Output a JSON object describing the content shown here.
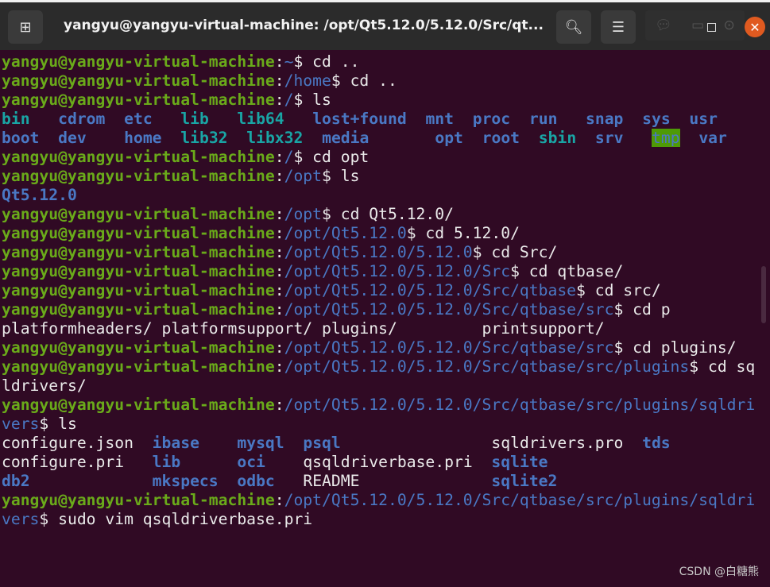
{
  "window": {
    "title": "yangyu@yangyu-virtual-machine: /opt/Qt5.12.0/5.12.0/Src/qt...",
    "new_tab_icon": "new-tab-icon",
    "search_icon": "search-icon",
    "menu_icon": "hamburger-menu-icon",
    "close_icon": "close-icon"
  },
  "colors": {
    "background": "#300a24",
    "prompt_user": "#6aaa1a",
    "prompt_path": "#4a78c4",
    "directory": "#4a78c4",
    "symlink": "#19a5a5",
    "sticky_dir_bg": "#4e9a06",
    "close_button": "#e05a20"
  },
  "terminal": {
    "lines": [
      [
        [
          "yangyu@yangyu-virtual-machine",
          "g"
        ],
        [
          ":",
          "w"
        ],
        [
          "~",
          "b"
        ],
        [
          "$ cd ..",
          "w"
        ]
      ],
      [
        [
          "yangyu@yangyu-virtual-machine",
          "g"
        ],
        [
          ":",
          "w"
        ],
        [
          "/home",
          "b"
        ],
        [
          "$ cd ..",
          "w"
        ]
      ],
      [
        [
          "yangyu@yangyu-virtual-machine",
          "g"
        ],
        [
          ":",
          "w"
        ],
        [
          "/",
          "b"
        ],
        [
          "$ ls",
          "w"
        ]
      ],
      [
        [
          "bin",
          "c"
        ],
        [
          "   ",
          "w"
        ],
        [
          "cdrom",
          "bb"
        ],
        [
          "  ",
          "w"
        ],
        [
          "etc",
          "bb"
        ],
        [
          "   ",
          "w"
        ],
        [
          "lib",
          "c"
        ],
        [
          "   ",
          "w"
        ],
        [
          "lib64",
          "c"
        ],
        [
          "   ",
          "w"
        ],
        [
          "lost+found",
          "bb"
        ],
        [
          "  ",
          "w"
        ],
        [
          "mnt",
          "bb"
        ],
        [
          "  ",
          "w"
        ],
        [
          "proc",
          "bb"
        ],
        [
          "  ",
          "w"
        ],
        [
          "run",
          "bb"
        ],
        [
          "   ",
          "w"
        ],
        [
          "snap",
          "bb"
        ],
        [
          "  ",
          "w"
        ],
        [
          "sys",
          "bb"
        ],
        [
          "  ",
          "w"
        ],
        [
          "usr",
          "bb"
        ]
      ],
      [
        [
          "boot",
          "bb"
        ],
        [
          "  ",
          "w"
        ],
        [
          "dev",
          "bb"
        ],
        [
          "    ",
          "w"
        ],
        [
          "home",
          "bb"
        ],
        [
          "  ",
          "w"
        ],
        [
          "lib32",
          "c"
        ],
        [
          "  ",
          "w"
        ],
        [
          "libx32",
          "c"
        ],
        [
          "  ",
          "w"
        ],
        [
          "media",
          "bb"
        ],
        [
          "       ",
          "w"
        ],
        [
          "opt",
          "bb"
        ],
        [
          "  ",
          "w"
        ],
        [
          "root",
          "bb"
        ],
        [
          "  ",
          "w"
        ],
        [
          "sbin",
          "c"
        ],
        [
          "  ",
          "w"
        ],
        [
          "srv",
          "bb"
        ],
        [
          "   ",
          "w"
        ],
        [
          "tmp",
          "hl"
        ],
        [
          "  ",
          "w"
        ],
        [
          "var",
          "bb"
        ]
      ],
      [
        [
          "yangyu@yangyu-virtual-machine",
          "g"
        ],
        [
          ":",
          "w"
        ],
        [
          "/",
          "b"
        ],
        [
          "$ cd opt",
          "w"
        ]
      ],
      [
        [
          "yangyu@yangyu-virtual-machine",
          "g"
        ],
        [
          ":",
          "w"
        ],
        [
          "/opt",
          "b"
        ],
        [
          "$ ls",
          "w"
        ]
      ],
      [
        [
          "Qt5.12.0",
          "bb"
        ]
      ],
      [
        [
          "yangyu@yangyu-virtual-machine",
          "g"
        ],
        [
          ":",
          "w"
        ],
        [
          "/opt",
          "b"
        ],
        [
          "$ cd Qt5.12.0/",
          "w"
        ]
      ],
      [
        [
          "yangyu@yangyu-virtual-machine",
          "g"
        ],
        [
          ":",
          "w"
        ],
        [
          "/opt/Qt5.12.0",
          "b"
        ],
        [
          "$ cd 5.12.0/",
          "w"
        ]
      ],
      [
        [
          "yangyu@yangyu-virtual-machine",
          "g"
        ],
        [
          ":",
          "w"
        ],
        [
          "/opt/Qt5.12.0/5.12.0",
          "b"
        ],
        [
          "$ cd Src/",
          "w"
        ]
      ],
      [
        [
          "yangyu@yangyu-virtual-machine",
          "g"
        ],
        [
          ":",
          "w"
        ],
        [
          "/opt/Qt5.12.0/5.12.0/Src",
          "b"
        ],
        [
          "$ cd qtbase/",
          "w"
        ]
      ],
      [
        [
          "yangyu@yangyu-virtual-machine",
          "g"
        ],
        [
          ":",
          "w"
        ],
        [
          "/opt/Qt5.12.0/5.12.0/Src/qtbase",
          "b"
        ],
        [
          "$ cd src/",
          "w"
        ]
      ],
      [
        [
          "yangyu@yangyu-virtual-machine",
          "g"
        ],
        [
          ":",
          "w"
        ],
        [
          "/opt/Qt5.12.0/5.12.0/Src/qtbase/src",
          "b"
        ],
        [
          "$ cd p",
          "w"
        ]
      ],
      [
        [
          "platformheaders/ platformsupport/ plugins/         printsupport/",
          "w"
        ]
      ],
      [
        [
          "yangyu@yangyu-virtual-machine",
          "g"
        ],
        [
          ":",
          "w"
        ],
        [
          "/opt/Qt5.12.0/5.12.0/Src/qtbase/src",
          "b"
        ],
        [
          "$ cd plugins/",
          "w"
        ]
      ],
      [
        [
          "yangyu@yangyu-virtual-machine",
          "g"
        ],
        [
          ":",
          "w"
        ],
        [
          "/opt/Qt5.12.0/5.12.0/Src/qtbase/src/plugins",
          "b"
        ],
        [
          "$ cd sq",
          "w"
        ]
      ],
      [
        [
          "ldrivers/",
          "w"
        ]
      ],
      [
        [
          "yangyu@yangyu-virtual-machine",
          "g"
        ],
        [
          ":",
          "w"
        ],
        [
          "/opt/Qt5.12.0/5.12.0/Src/qtbase/src/plugins/sqldri",
          "b"
        ]
      ],
      [
        [
          "vers",
          "b"
        ],
        [
          "$ ls",
          "w"
        ]
      ],
      [
        [
          "configure.json",
          "w"
        ],
        [
          "  ",
          "w"
        ],
        [
          "ibase",
          "bb"
        ],
        [
          "    ",
          "w"
        ],
        [
          "mysql",
          "bb"
        ],
        [
          "  ",
          "w"
        ],
        [
          "psql",
          "bb"
        ],
        [
          "                ",
          "w"
        ],
        [
          "sqldrivers.pro",
          "w"
        ],
        [
          "  ",
          "w"
        ],
        [
          "tds",
          "bb"
        ]
      ],
      [
        [
          "configure.pri",
          "w"
        ],
        [
          "   ",
          "w"
        ],
        [
          "lib",
          "bb"
        ],
        [
          "      ",
          "w"
        ],
        [
          "oci",
          "bb"
        ],
        [
          "    ",
          "w"
        ],
        [
          "qsqldriverbase.pri",
          "w"
        ],
        [
          "  ",
          "w"
        ],
        [
          "sqlite",
          "bb"
        ]
      ],
      [
        [
          "db2",
          "bb"
        ],
        [
          "             ",
          "w"
        ],
        [
          "mkspecs",
          "bb"
        ],
        [
          "  ",
          "w"
        ],
        [
          "odbc",
          "bb"
        ],
        [
          "   ",
          "w"
        ],
        [
          "README",
          "w"
        ],
        [
          "              ",
          "w"
        ],
        [
          "sqlite2",
          "bb"
        ]
      ],
      [
        [
          "yangyu@yangyu-virtual-machine",
          "g"
        ],
        [
          ":",
          "w"
        ],
        [
          "/opt/Qt5.12.0/5.12.0/Src/qtbase/src/plugins/sqldri",
          "b"
        ]
      ],
      [
        [
          "vers",
          "b"
        ],
        [
          "$ sudo vim qsqldriverbase.pri",
          "w"
        ]
      ]
    ]
  },
  "watermark": "CSDN @白糖熊"
}
